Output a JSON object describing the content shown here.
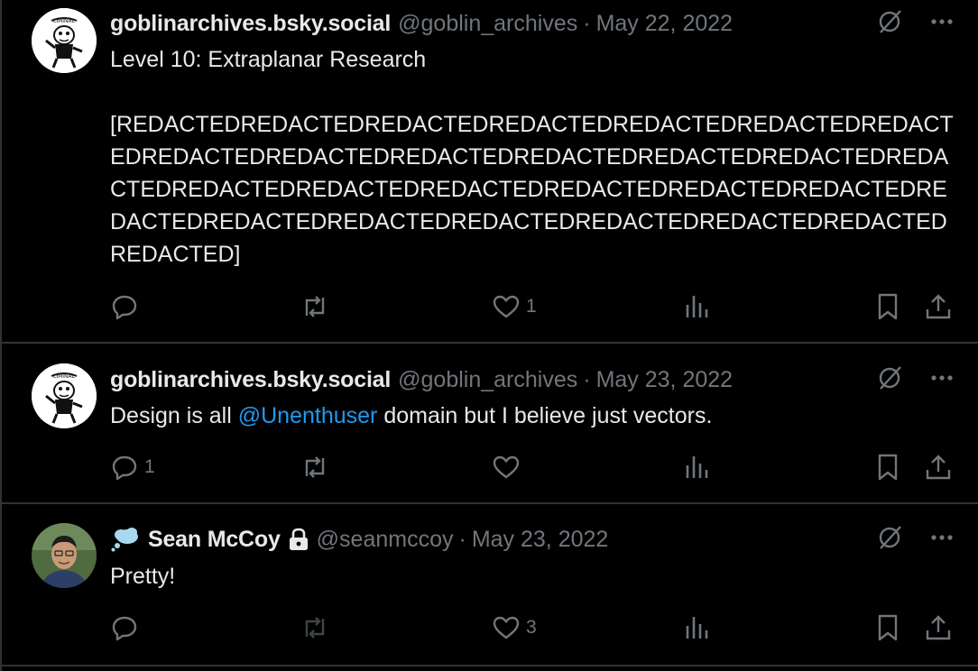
{
  "posts": [
    {
      "name": "goblinarchives.bsky.social",
      "handle": "@goblin_archives",
      "separator": "·",
      "date": "May 22, 2022",
      "text_title": "Level 10: Extraplanar Research",
      "text_body": "[REDACTEDREDACTEDREDACTEDREDACTEDREDACTEDREDACTEDREDACTEDREDACTEDREDACTEDREDACTEDREDACTEDREDACTEDREDACTEDREDACTEDREDACTEDREDACTEDREDACTEDREDACTEDREDACTEDREDACTEDREDACTEDREDACTEDREDACTEDREDACTEDREDACTEDREDACTEDREDACTEDREDACTED]",
      "reply_count": "",
      "repost_count": "",
      "like_count": "1"
    },
    {
      "name": "goblinarchives.bsky.social",
      "handle": "@goblin_archives",
      "separator": "·",
      "date": "May 23, 2022",
      "text_before": "Design is all ",
      "mention": "@Unenthuser",
      "text_after": " domain but I believe just vectors.",
      "reply_count": "1",
      "repost_count": "",
      "like_count": ""
    },
    {
      "name": "Sean McCoy",
      "handle": "@seanmccoy",
      "separator": "·",
      "date": "May 23, 2022",
      "text": "Pretty!",
      "reply_count": "",
      "repost_count": "",
      "like_count": "3"
    }
  ],
  "icons": {
    "reply": "reply-icon",
    "repost": "repost-icon",
    "like": "heart-icon",
    "views": "views-icon",
    "bookmark": "bookmark-icon",
    "share": "share-icon",
    "hide": "hidden-slash-icon",
    "more": "more-icon",
    "badge": "thought-bubble-icon",
    "lock": "lock-icon"
  },
  "colors": {
    "background": "#000000",
    "text": "#e7e9ea",
    "muted": "#71767b",
    "link": "#1d9bf0",
    "divider": "#2f3336"
  }
}
